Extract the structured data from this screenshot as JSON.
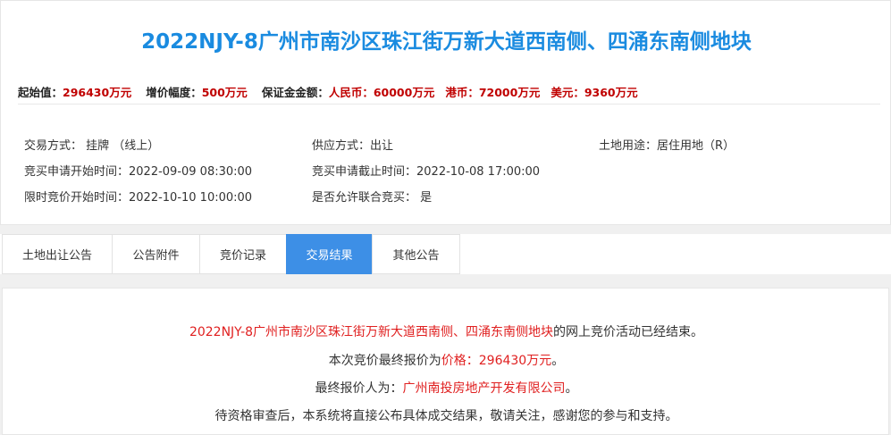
{
  "header": {
    "title": "2022NJY-8广州市南沙区珠江街万新大道西南侧、四涌东南侧地块"
  },
  "prices": {
    "start_label": "起始值：",
    "start_value": "296430万元",
    "increment_label": "增价幅度：",
    "increment_value": "500万元",
    "deposit_label": "保证金金额：",
    "rmb": "人民币：60000万元",
    "hkd": "港币：72000万元",
    "usd": "美元：9360万元"
  },
  "info": {
    "trade_mode": "交易方式： 挂牌 （线上）",
    "supply_mode": "供应方式：出让",
    "land_use": "土地用途：居住用地（R）",
    "apply_start": "竞买申请开始时间：2022-09-09 08:30:00",
    "apply_end": "竞买申请截止时间：2022-10-08 17:00:00",
    "bid_start": "限时竞价开始时间：2022-10-10 10:00:00",
    "joint_bid": "是否允许联合竞买： 是"
  },
  "tabs": [
    {
      "label": "土地出让公告"
    },
    {
      "label": "公告附件"
    },
    {
      "label": "竞价记录"
    },
    {
      "label": "交易结果"
    },
    {
      "label": "其他公告"
    }
  ],
  "result": {
    "parcel": "2022NJY-8广州市南沙区珠江街万新大道西南侧、四涌东南侧地块",
    "ended_suffix": "的网上竞价活动已经结束。",
    "final_prefix": "本次竞价最终报价为",
    "final_price": "价格：296430万元",
    "final_suffix": "。",
    "bidder_prefix": "最终报价人为：",
    "bidder": "广州南投房地产开发有限公司",
    "bidder_suffix": "。",
    "notice": "待资格审查后，本系统将直接公布具体成交结果，敬请关注，感谢您的参与和支持。"
  },
  "colors": {
    "title_blue": "#1a8be0",
    "price_red": "#c00000",
    "active_tab": "#3d8fe6",
    "highlight_red": "#e02020"
  }
}
